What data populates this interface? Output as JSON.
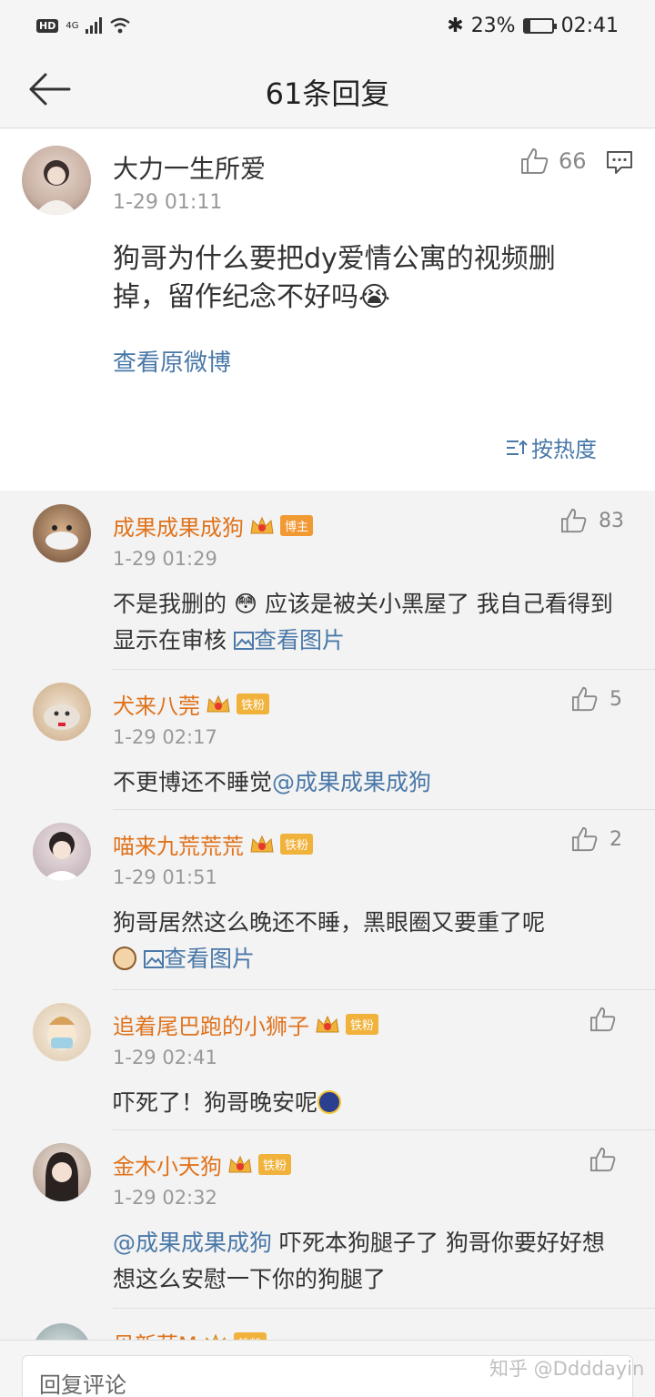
{
  "status_bar": {
    "network": "4G",
    "hd": "HD",
    "battery": "23%",
    "battery_level": 0.23,
    "time": "02:41"
  },
  "nav": {
    "title": "61条回复"
  },
  "main_post": {
    "username": "大力一生所爱",
    "time": "1-29 01:11",
    "likes": "66",
    "text": "狗哥为什么要把dy爱情公寓的视频删掉，留作纪念不好吗😭",
    "view_original": "查看原微博",
    "sort_label": "按热度"
  },
  "replies": [
    {
      "username": "成果成果成狗",
      "badge": "博主",
      "time": "1-29 01:29",
      "likes": "83",
      "text": "不是我删的 😳 应该是被关小黑屋了 我自己看得到 显示在审核 ",
      "link": "查看图片"
    },
    {
      "username": "犬来八莞",
      "badge": "铁粉",
      "time": "1-29 02:17",
      "likes": "5",
      "text": "不更博还不睡觉",
      "mention": "@成果成果成狗"
    },
    {
      "username": "喵来九荒荒荒",
      "badge": "铁粉",
      "time": "1-29 01:51",
      "likes": "2",
      "text": "狗哥居然这么晚还不睡，黑眼圈又要重了呢 ",
      "link": "查看图片"
    },
    {
      "username": "追着尾巴跑的小狮子",
      "badge": "铁粉",
      "time": "1-29 02:41",
      "likes": "",
      "text": "吓死了！狗哥晚安呢"
    },
    {
      "username": "金木小天狗",
      "badge": "铁粉",
      "time": "1-29 02:32",
      "likes": "",
      "mention": "@成果成果成狗",
      "text": " 吓死本狗腿子了 狗哥你要好好想想这么安慰一下你的狗腿了"
    },
    {
      "username": "贝新莅M",
      "badge": "铁粉"
    }
  ],
  "bottom": {
    "placeholder": "回复评论",
    "watermark": "知乎 @Ddddayin"
  },
  "colors": {
    "username": "#e0731c",
    "link": "#4a78a8",
    "badge_blogger": "#f19a34",
    "badge_fan": "#f0b23a"
  }
}
